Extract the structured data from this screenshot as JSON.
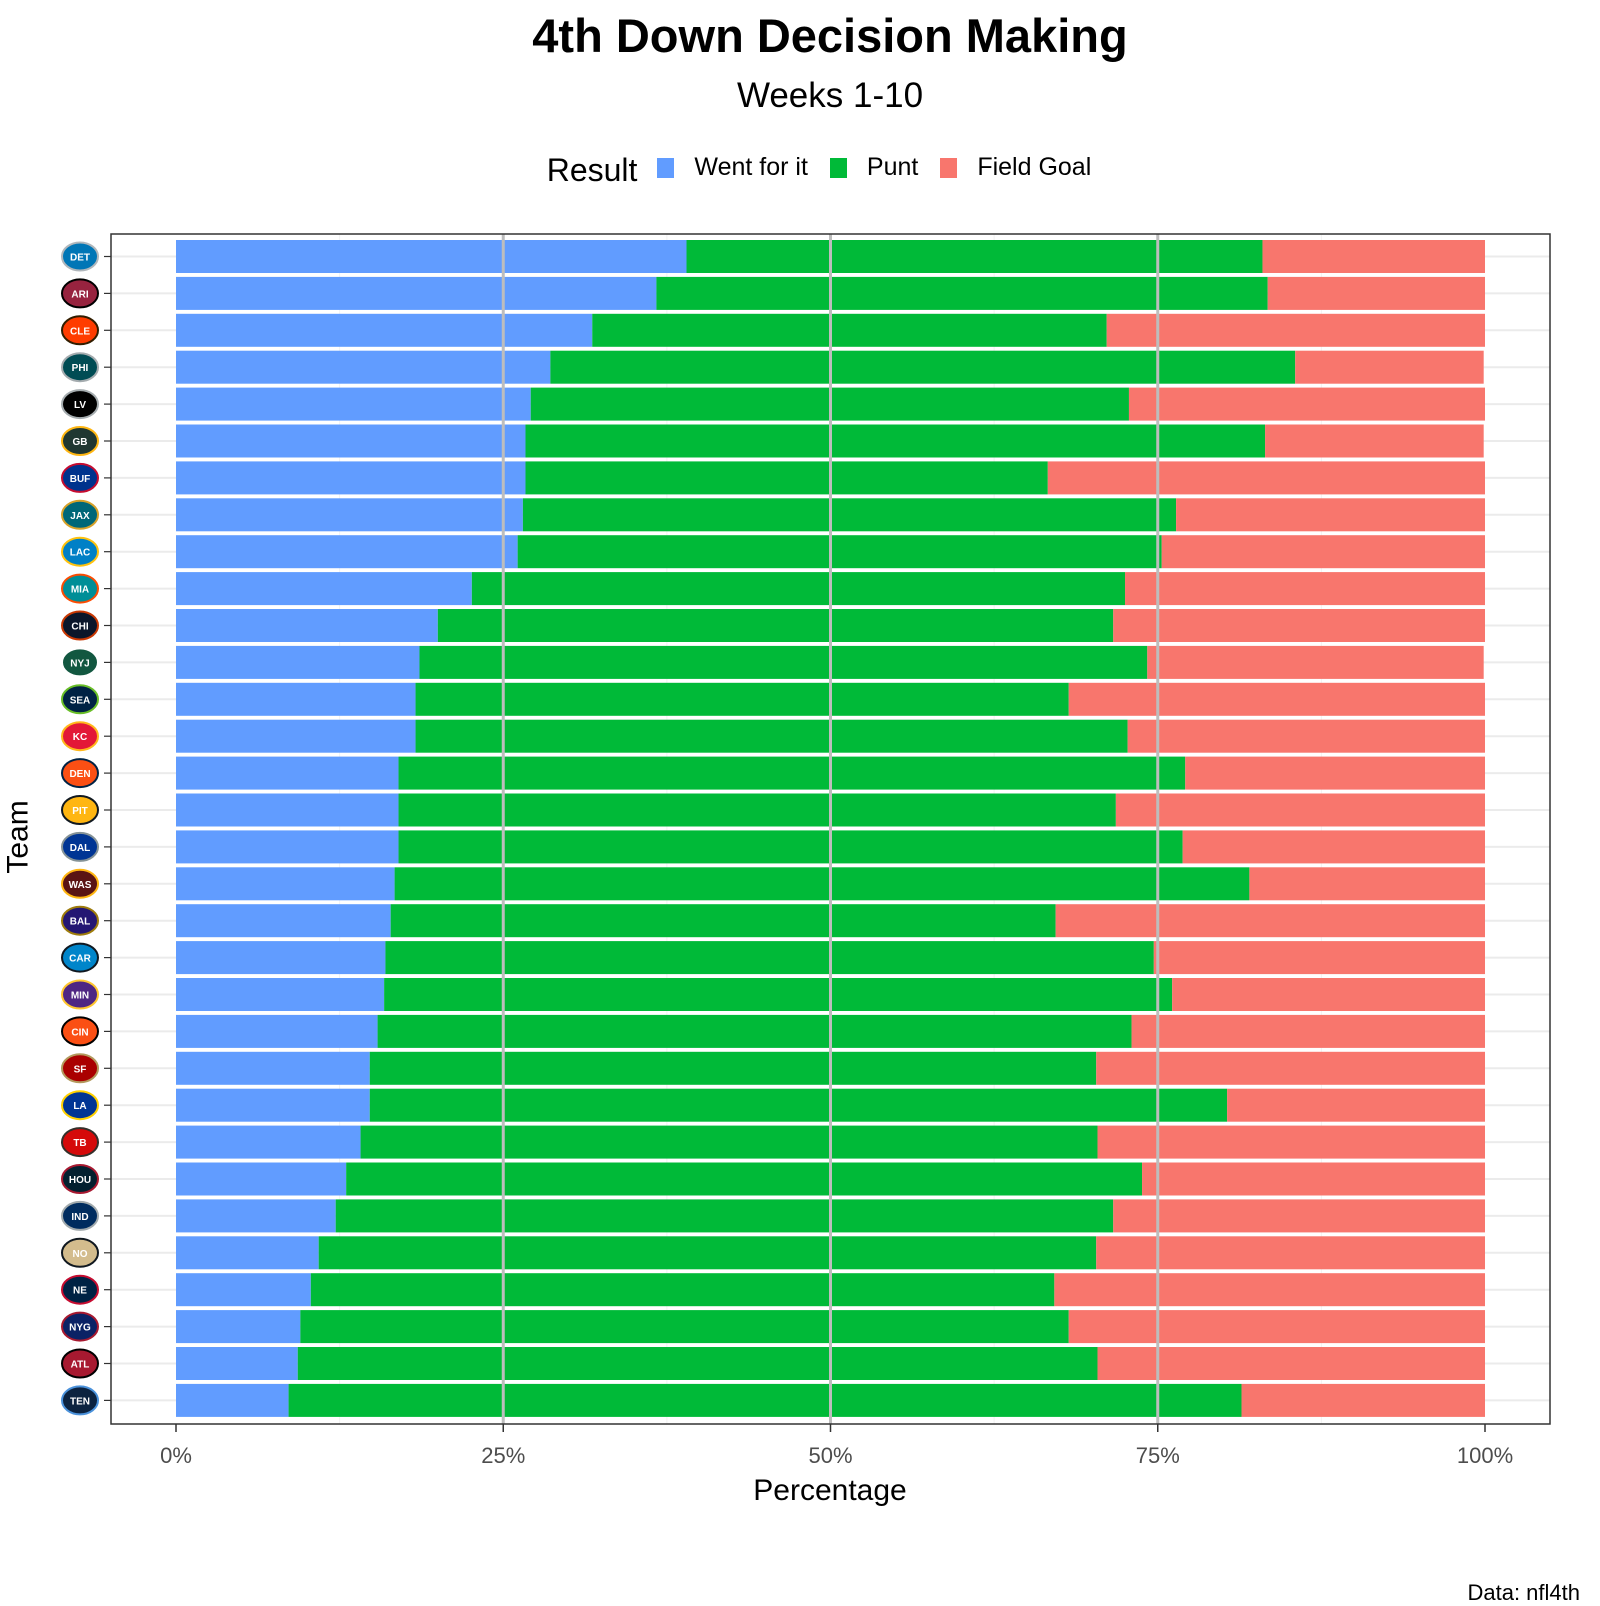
{
  "chart_data": {
    "type": "bar",
    "orientation": "horizontal",
    "stacked": true,
    "title": "4th Down Decision Making",
    "subtitle": "Weeks 1-10",
    "xlabel": "Percentage",
    "ylabel": "Team",
    "caption": "Data: nfl4th",
    "xlim": [
      0,
      100
    ],
    "xticks": [
      0,
      25,
      50,
      75,
      100
    ],
    "xtick_labels": [
      "0%",
      "25%",
      "50%",
      "75%",
      "100%"
    ],
    "grid": true,
    "legend": {
      "title": "Result",
      "position": "top",
      "entries": [
        {
          "label": "Went for it",
          "color": "#619CFF"
        },
        {
          "label": "Punt",
          "color": "#00BA38"
        },
        {
          "label": "Field Goal",
          "color": "#F8766D"
        }
      ]
    },
    "categories": [
      "DET",
      "ARI",
      "CLE",
      "PHI",
      "LV",
      "GB",
      "BUF",
      "JAX",
      "LAC",
      "MIA",
      "CHI",
      "NYJ",
      "SEA",
      "KC",
      "DEN",
      "PIT",
      "DAL",
      "WAS",
      "BAL",
      "CAR",
      "MIN",
      "CIN",
      "SF",
      "LA",
      "TB",
      "HOU",
      "IND",
      "NO",
      "NE",
      "NYG",
      "ATL",
      "TEN"
    ],
    "category_note": "Categories are shown as team logos, top to bottom",
    "series": [
      {
        "name": "Went for it",
        "color": "#619CFF",
        "values": [
          39.0,
          36.7,
          31.8,
          28.6,
          27.1,
          26.7,
          26.7,
          26.5,
          26.1,
          22.6,
          20.0,
          18.6,
          18.3,
          18.3,
          17.0,
          17.0,
          17.0,
          16.7,
          16.4,
          16.0,
          15.9,
          15.4,
          14.8,
          14.8,
          14.1,
          13.0,
          12.2,
          10.9,
          10.3,
          9.5,
          9.3,
          8.6
        ]
      },
      {
        "name": "Punt",
        "color": "#00BA38",
        "values": [
          44.0,
          46.7,
          39.3,
          56.9,
          45.7,
          56.5,
          39.9,
          49.9,
          49.2,
          49.9,
          51.6,
          55.6,
          49.9,
          54.4,
          60.1,
          54.8,
          59.9,
          65.3,
          50.8,
          58.7,
          60.2,
          57.6,
          55.5,
          65.5,
          56.3,
          60.8,
          59.4,
          59.4,
          56.8,
          58.7,
          61.1,
          72.8
        ]
      },
      {
        "name": "Field Goal",
        "color": "#F8766D",
        "values": [
          17.0,
          16.6,
          28.9,
          14.4,
          27.2,
          16.7,
          33.4,
          23.6,
          24.7,
          27.5,
          28.4,
          25.7,
          31.8,
          27.3,
          22.9,
          28.2,
          23.1,
          18.0,
          32.8,
          25.3,
          23.9,
          27.0,
          29.7,
          19.7,
          29.6,
          26.2,
          28.4,
          29.7,
          32.9,
          31.8,
          29.6,
          18.6
        ]
      }
    ],
    "team_colors": {
      "DET": [
        "#0076B6",
        "#B0B7BC"
      ],
      "ARI": [
        "#97233F",
        "#000000"
      ],
      "CLE": [
        "#FF3C00",
        "#311D00"
      ],
      "PHI": [
        "#004C54",
        "#A5ACAF"
      ],
      "LV": [
        "#000000",
        "#A5ACAF"
      ],
      "GB": [
        "#203731",
        "#FFB612"
      ],
      "BUF": [
        "#00338D",
        "#C60C30"
      ],
      "JAX": [
        "#006778",
        "#D7A22A"
      ],
      "LAC": [
        "#0080C6",
        "#FFC20E"
      ],
      "MIA": [
        "#008E97",
        "#FC4C02"
      ],
      "CHI": [
        "#0B162A",
        "#C83803"
      ],
      "NYJ": [
        "#125740",
        "#FFFFFF"
      ],
      "SEA": [
        "#002244",
        "#69BE28"
      ],
      "KC": [
        "#E31837",
        "#FFB81C"
      ],
      "DEN": [
        "#FB4F14",
        "#002244"
      ],
      "PIT": [
        "#FFB612",
        "#101820"
      ],
      "DAL": [
        "#003594",
        "#869397"
      ],
      "WAS": [
        "#5A1414",
        "#FFB612"
      ],
      "BAL": [
        "#241773",
        "#9E7C0C"
      ],
      "CAR": [
        "#0085CA",
        "#101820"
      ],
      "MIN": [
        "#4F2683",
        "#FFC62F"
      ],
      "CIN": [
        "#FB4F14",
        "#000000"
      ],
      "SF": [
        "#AA0000",
        "#B3995D"
      ],
      "LA": [
        "#003594",
        "#FFD100"
      ],
      "TB": [
        "#D50A0A",
        "#34302B"
      ],
      "HOU": [
        "#03202F",
        "#A71930"
      ],
      "IND": [
        "#002C5F",
        "#A2AAAD"
      ],
      "NO": [
        "#D3BC8D",
        "#101820"
      ],
      "NE": [
        "#002244",
        "#C60C30"
      ],
      "NYG": [
        "#0B2265",
        "#A71930"
      ],
      "ATL": [
        "#A71930",
        "#000000"
      ],
      "TEN": [
        "#0C2340",
        "#4B92DB"
      ]
    }
  }
}
